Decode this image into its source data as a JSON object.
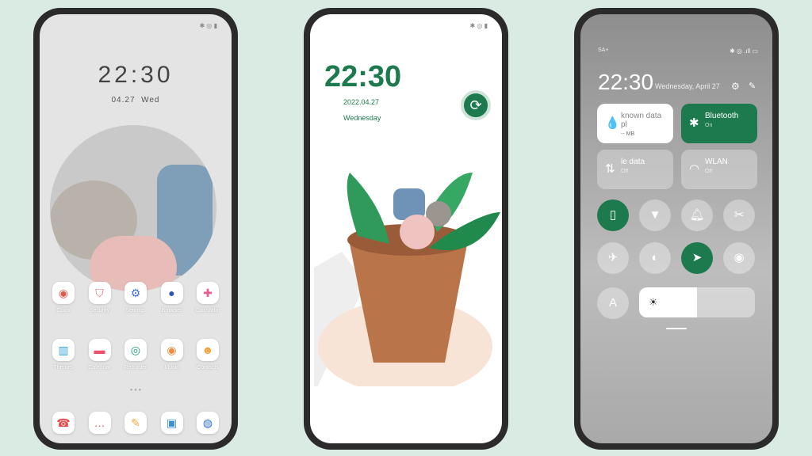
{
  "phone1": {
    "time": "22:30",
    "date": "04.27",
    "weekday": "Wed",
    "row1": [
      {
        "label": "Clock",
        "icon": "◉",
        "color": "#e05a4e"
      },
      {
        "label": "Security",
        "icon": "⛉",
        "color": "#e96b7a"
      },
      {
        "label": "Settings",
        "icon": "⚙",
        "color": "#3a6fd8"
      },
      {
        "label": "Browser",
        "icon": "●",
        "color": "#2f55b8"
      },
      {
        "label": "Calculator",
        "icon": "✚",
        "color": "#ef5b8a"
      }
    ],
    "row2": [
      {
        "label": "Themes",
        "icon": "▥",
        "color": "#3aa0d6"
      },
      {
        "label": "Calendar",
        "icon": "▬",
        "color": "#f04e66"
      },
      {
        "label": "Recorder",
        "icon": "◎",
        "color": "#1f9c72"
      },
      {
        "label": "Music",
        "icon": "◉",
        "color": "#f08a3e"
      },
      {
        "label": "Contacts",
        "icon": "☻",
        "color": "#f3a23c"
      }
    ],
    "dock": [
      {
        "label": "phone",
        "icon": "☎",
        "color": "#e44a4a"
      },
      {
        "label": "messages",
        "icon": "…",
        "color": "#ef4f5e"
      },
      {
        "label": "notes",
        "icon": "✎",
        "color": "#f2a93b"
      },
      {
        "label": "gallery",
        "icon": "▣",
        "color": "#3b8ed8"
      },
      {
        "label": "camera",
        "icon": "◍",
        "color": "#2d6fc4"
      }
    ]
  },
  "phone2": {
    "time": "22:30",
    "date": "2022.04.27",
    "weekday": "Wednesday"
  },
  "phone3": {
    "carrier": "SA+",
    "time": "22:30",
    "date": "Wednesday, April 27",
    "tiles": [
      {
        "title": "known data pl",
        "sub": "-- MB",
        "icon": "💧"
      },
      {
        "title": "Bluetooth",
        "sub": "On",
        "icon": "✱"
      },
      {
        "title": "le data",
        "sub": "Off",
        "icon": "⇅"
      },
      {
        "title": "WLAN",
        "sub": "Off",
        "icon": "◠"
      }
    ],
    "auto_brightness": "A",
    "brightness_percent": 50,
    "accent": "#1c7a4e"
  }
}
